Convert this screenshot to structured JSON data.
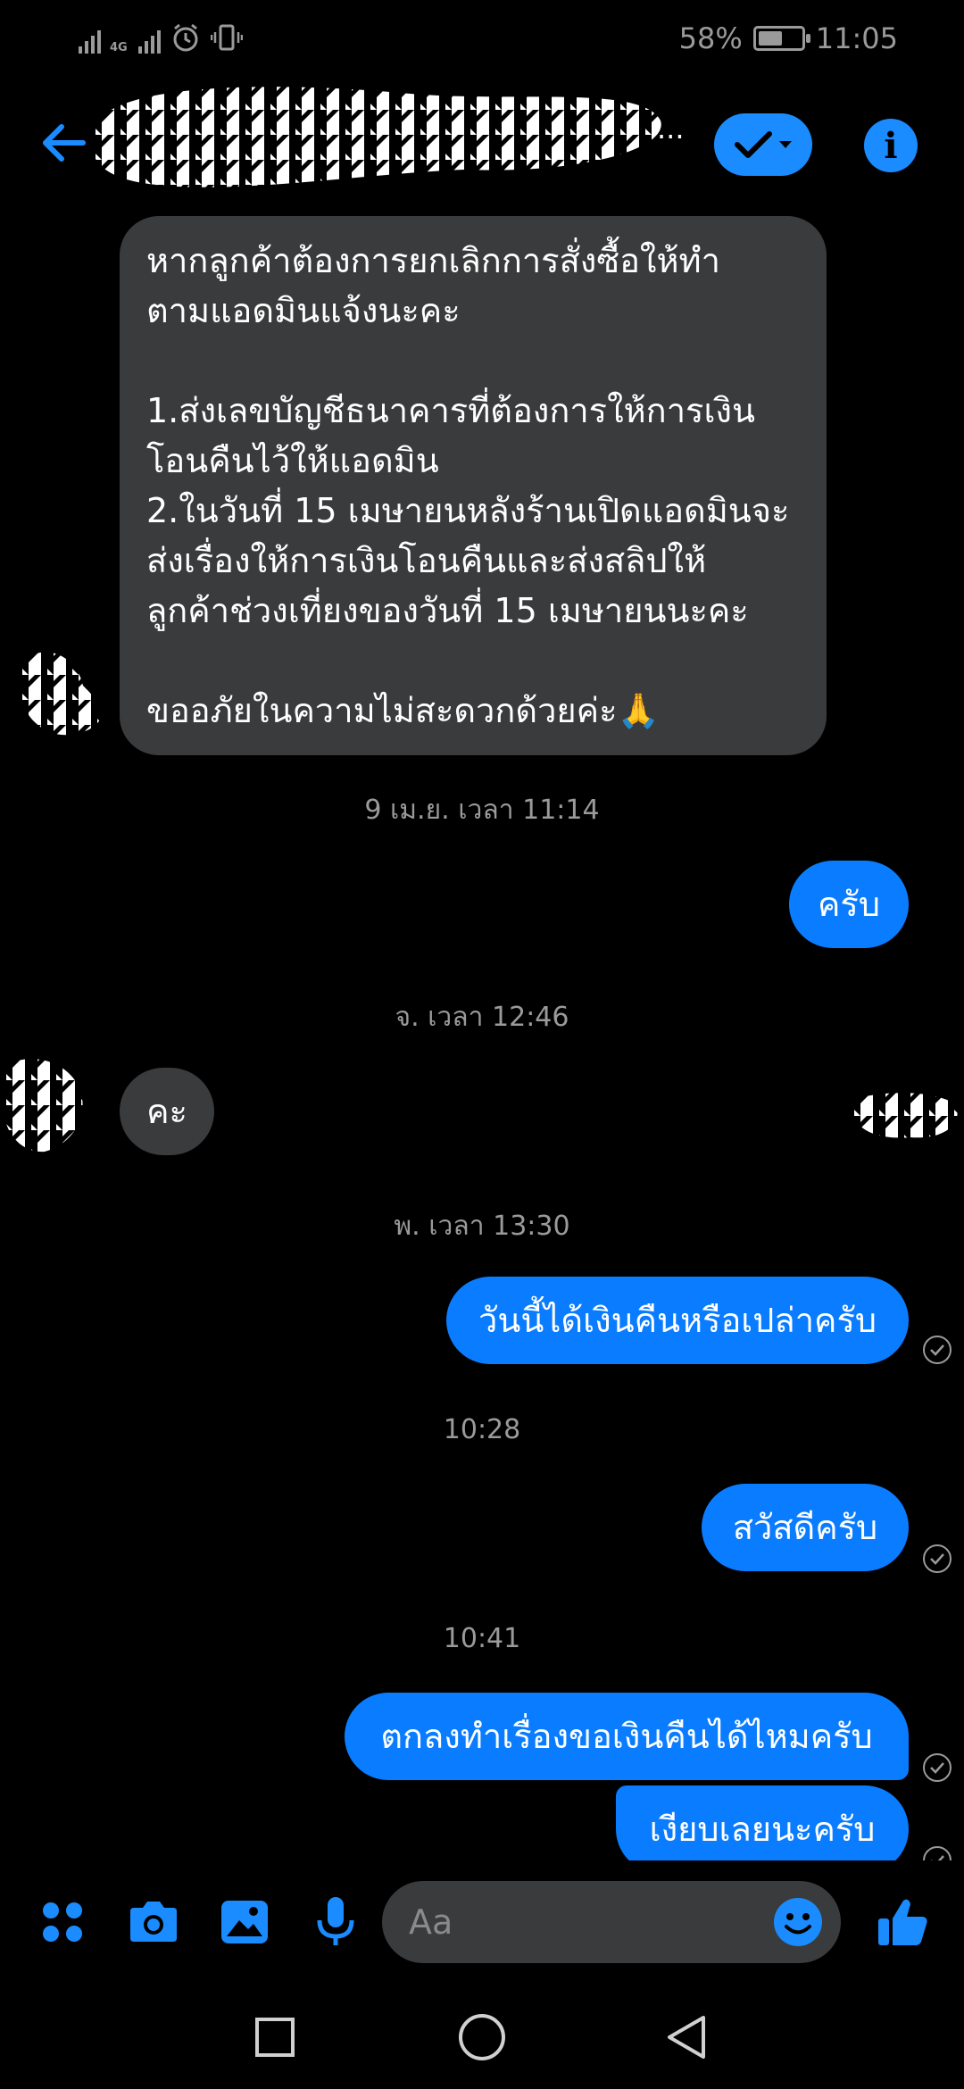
{
  "status_bar": {
    "network": "4G",
    "battery_percent_label": "58%",
    "battery_level": 0.58,
    "time": "11:05"
  },
  "header": {
    "title_suffix": "...",
    "icons": {
      "back": "arrow-left-icon",
      "status": "check-dropdown-icon",
      "info": "info-icon"
    }
  },
  "messages": {
    "long_incoming": "หากลูกค้าต้องการยกเลิกการสั่งซื้อให้ทำ\nตามแอดมินแจ้งนะคะ\n\n1.ส่งเลขบัญชีธนาคารที่ต้องการให้การเงิน\nโอนคืนไว้ให้แอดมิน\n2.ในวันที่ 15 เมษายนหลังร้านเปิดแอดมินจะ\nส่งเรื่องให้การเงินโอนคืนและส่งสลิปให้\nลูกค้าช่วงเที่ยงของวันที่ 15 เมษายนนะคะ\n\nขออภัยในความไม่สะดวกด้วยค่ะ🙏",
    "ts1": "9 เม.ย. เวลา 11:14",
    "out1": "ครับ",
    "ts2": "จ. เวลา 12:46",
    "in2": "คะ",
    "ts3": "พ. เวลา 13:30",
    "out2": "วันนี้ได้เงินคืนหรือเปล่าครับ",
    "ts4": "10:28",
    "out3": "สวัสดีครับ",
    "ts5": "10:41",
    "out4": "ตกลงทำเรื่องขอเงินคืนได้ไหมครับ",
    "out5": "เงียบเลยนะครับ"
  },
  "composer": {
    "placeholder": "Aa",
    "icons": [
      "apps-icon",
      "camera-icon",
      "gallery-icon",
      "microphone-icon",
      "emoji-icon",
      "thumbs-up-icon"
    ]
  },
  "nav": {
    "icons": [
      "recent-apps-icon",
      "home-icon",
      "back-icon"
    ]
  },
  "colors": {
    "accent": "#0a7cff",
    "incoming_bubble": "#3a3b3c",
    "timestamp": "#9a9a9a",
    "background": "#000000"
  }
}
